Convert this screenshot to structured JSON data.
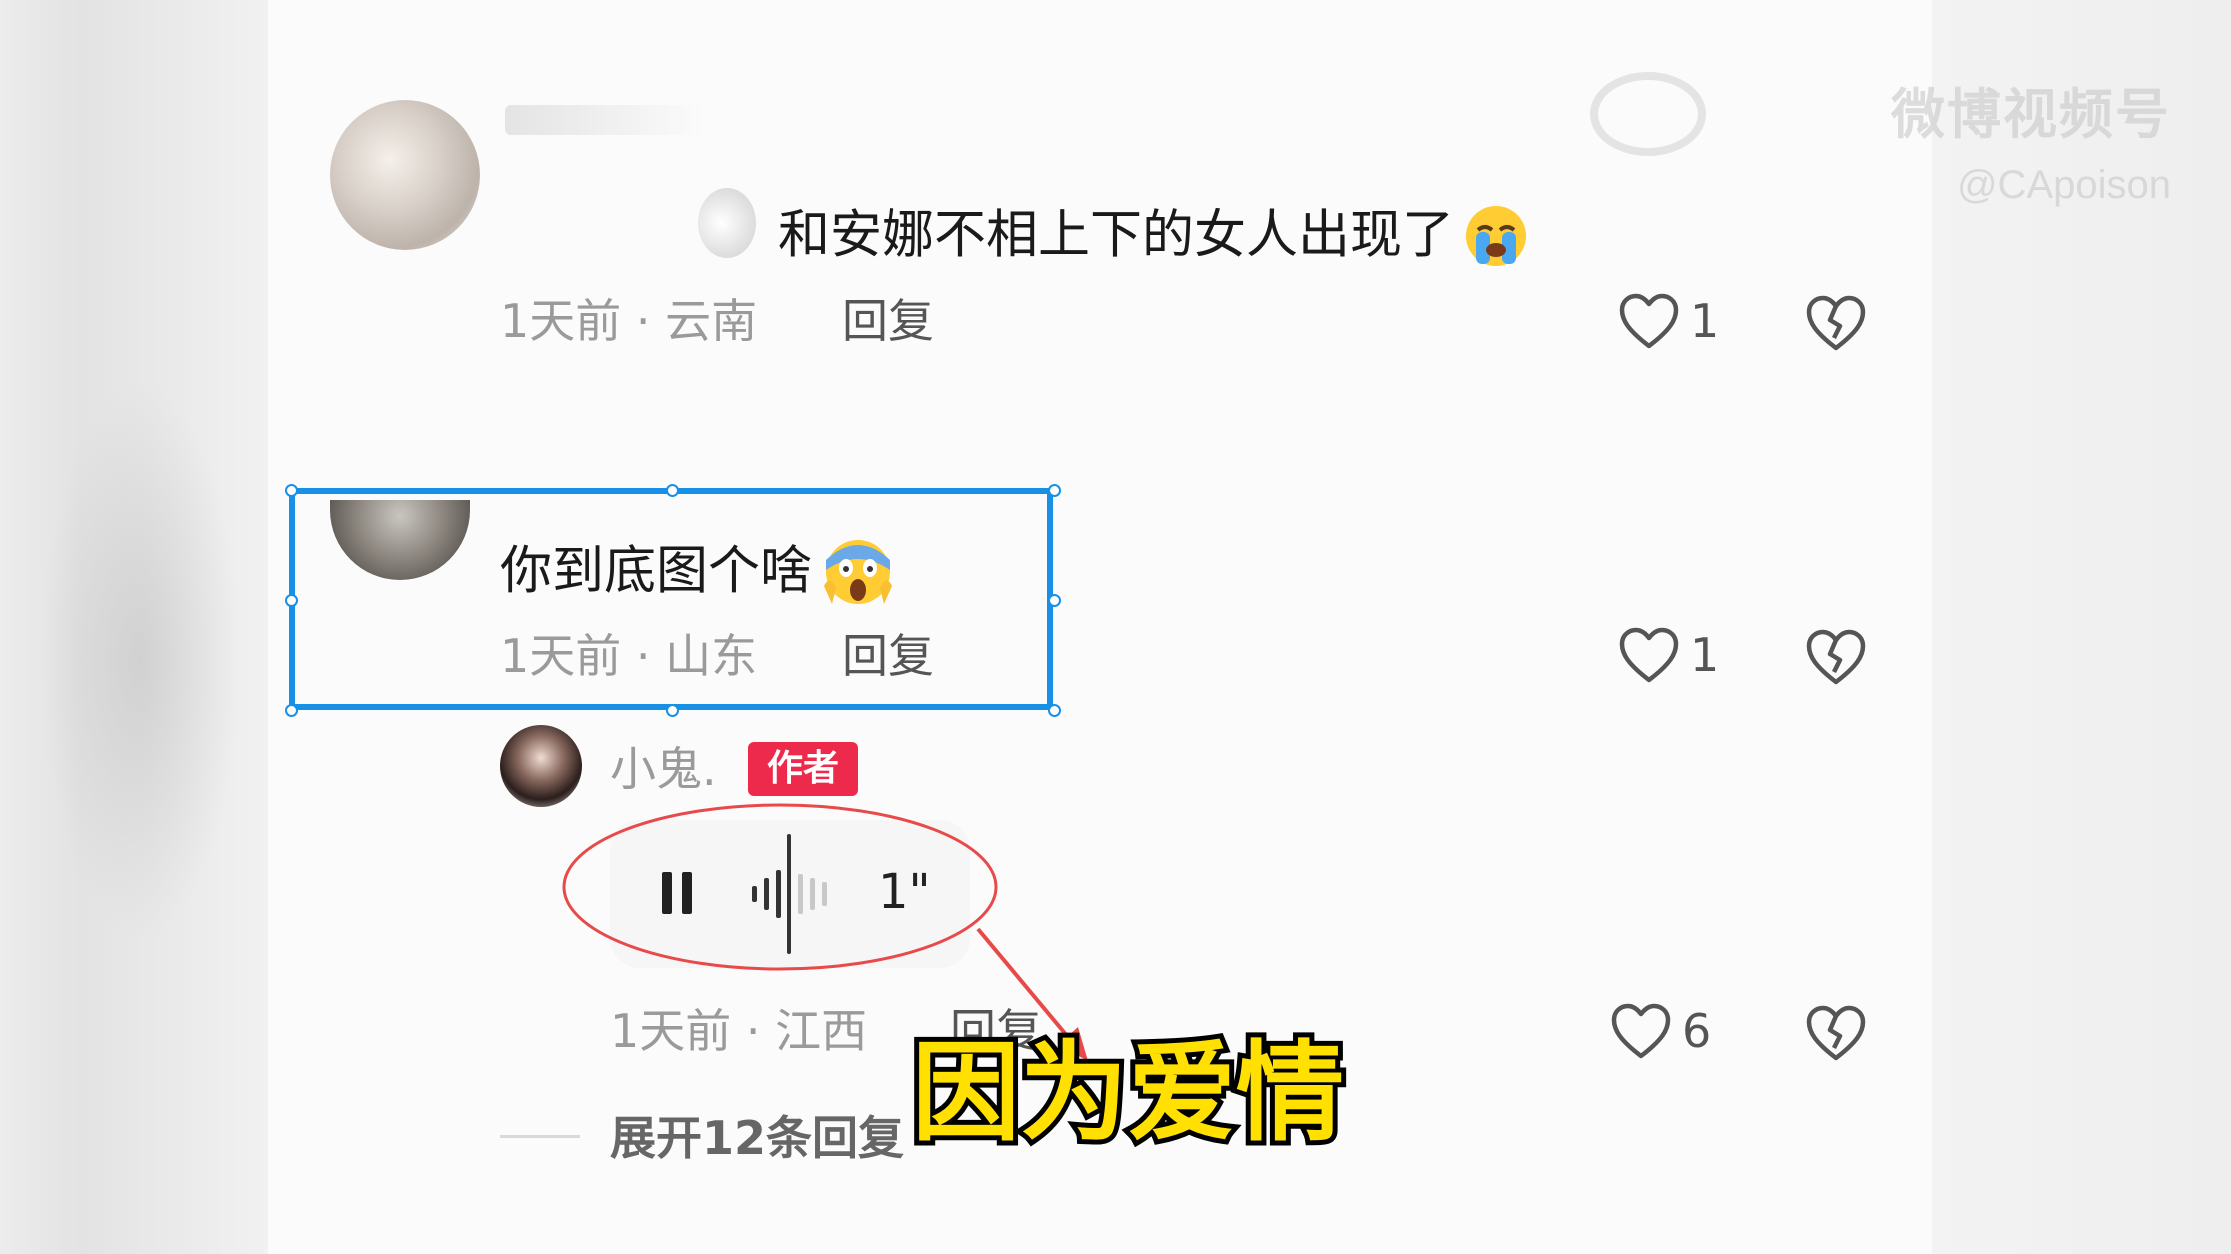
{
  "watermark": {
    "title": "微博视频号",
    "handle": "@CApoison"
  },
  "comments": [
    {
      "text": "和安娜不相上下的女人出现了",
      "emoji": "loudly-crying-face",
      "meta": "1天前 · 云南",
      "reply_label": "回复",
      "likes": "1"
    },
    {
      "text": "你到底图个啥",
      "emoji": "face-screaming-in-fear",
      "meta": "1天前 · 山东",
      "reply_label": "回复",
      "likes": "1"
    }
  ],
  "author_reply": {
    "name": "小鬼.",
    "badge": "作者",
    "voice_duration": "1\"",
    "meta": "1天前 · 江西",
    "reply_label": "回复",
    "likes": "6"
  },
  "expand_label": "展开12条回复",
  "caption": "因为爱情",
  "colors": {
    "selection": "#1890e6",
    "annotation": "#e84a4a",
    "badge": "#ee2a4c",
    "caption_fill": "#ffe000"
  }
}
